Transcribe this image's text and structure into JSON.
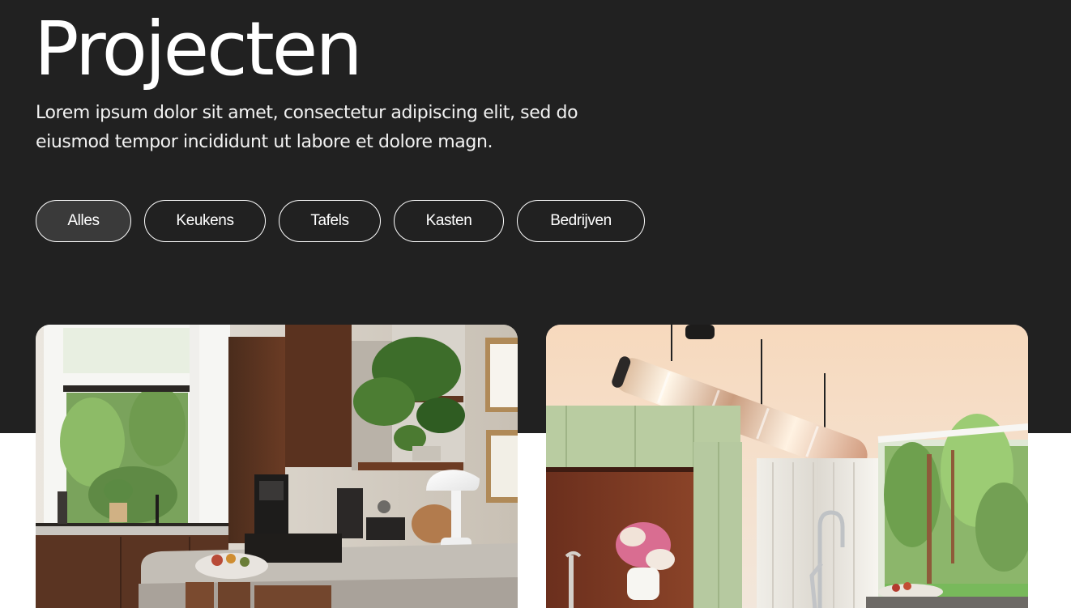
{
  "page": {
    "title": "Projecten",
    "intro": "Lorem ipsum dolor sit amet, consectetur adipiscing elit, sed do eiusmod tempor incididunt ut labore et dolore magn."
  },
  "filters": [
    {
      "label": "Alles",
      "active": true
    },
    {
      "label": "Keukens",
      "active": false
    },
    {
      "label": "Tafels",
      "active": false
    },
    {
      "label": "Kasten",
      "active": false
    },
    {
      "label": "Bedrijven",
      "active": false
    }
  ],
  "colors": {
    "hero_background": "#212121",
    "text": "#ffffff",
    "active_pill": "#3a3a3a",
    "page_background": "#ffffff"
  }
}
